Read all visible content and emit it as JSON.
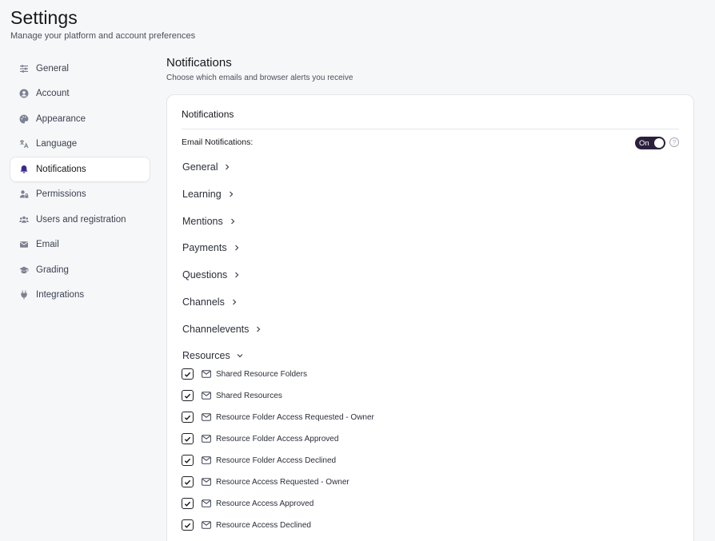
{
  "header": {
    "title": "Settings",
    "subtitle": "Manage your platform and account preferences"
  },
  "sidebar": {
    "items": [
      {
        "label": "General",
        "icon": "sliders-icon",
        "active": false
      },
      {
        "label": "Account",
        "icon": "user-circle-icon",
        "active": false
      },
      {
        "label": "Appearance",
        "icon": "palette-icon",
        "active": false
      },
      {
        "label": "Language",
        "icon": "translate-icon",
        "active": false
      },
      {
        "label": "Notifications",
        "icon": "bell-icon",
        "active": true
      },
      {
        "label": "Permissions",
        "icon": "user-lock-icon",
        "active": false
      },
      {
        "label": "Users and registration",
        "icon": "users-icon",
        "active": false
      },
      {
        "label": "Email",
        "icon": "envelope-icon",
        "active": false
      },
      {
        "label": "Grading",
        "icon": "graduation-cap-icon",
        "active": false
      },
      {
        "label": "Integrations",
        "icon": "plug-icon",
        "active": false
      }
    ]
  },
  "main": {
    "title": "Notifications",
    "subtitle": "Choose which emails and browser alerts you receive",
    "card": {
      "title": "Notifications",
      "email_label": "Email Notifications:",
      "toggle_label": "On",
      "help_glyph": "?",
      "categories": [
        {
          "label": "General",
          "expanded": false
        },
        {
          "label": "Learning",
          "expanded": false
        },
        {
          "label": "Mentions",
          "expanded": false
        },
        {
          "label": "Payments",
          "expanded": false
        },
        {
          "label": "Questions",
          "expanded": false
        },
        {
          "label": "Channels",
          "expanded": false
        },
        {
          "label": "Channelevents",
          "expanded": false
        },
        {
          "label": "Resources",
          "expanded": true
        }
      ],
      "resource_items": [
        {
          "label": "Shared Resource Folders",
          "checked": true
        },
        {
          "label": "Shared Resources",
          "checked": true
        },
        {
          "label": "Resource Folder Access Requested - Owner",
          "checked": true
        },
        {
          "label": "Resource Folder Access Approved",
          "checked": true
        },
        {
          "label": "Resource Folder Access Declined",
          "checked": true
        },
        {
          "label": "Resource Access Requested - Owner",
          "checked": true
        },
        {
          "label": "Resource Access Approved",
          "checked": true
        },
        {
          "label": "Resource Access Declined",
          "checked": true
        }
      ]
    }
  },
  "colors": {
    "accent": "#3a2a8c",
    "toggle_bg": "#2b1f3d",
    "background": "#f6f7f9"
  }
}
